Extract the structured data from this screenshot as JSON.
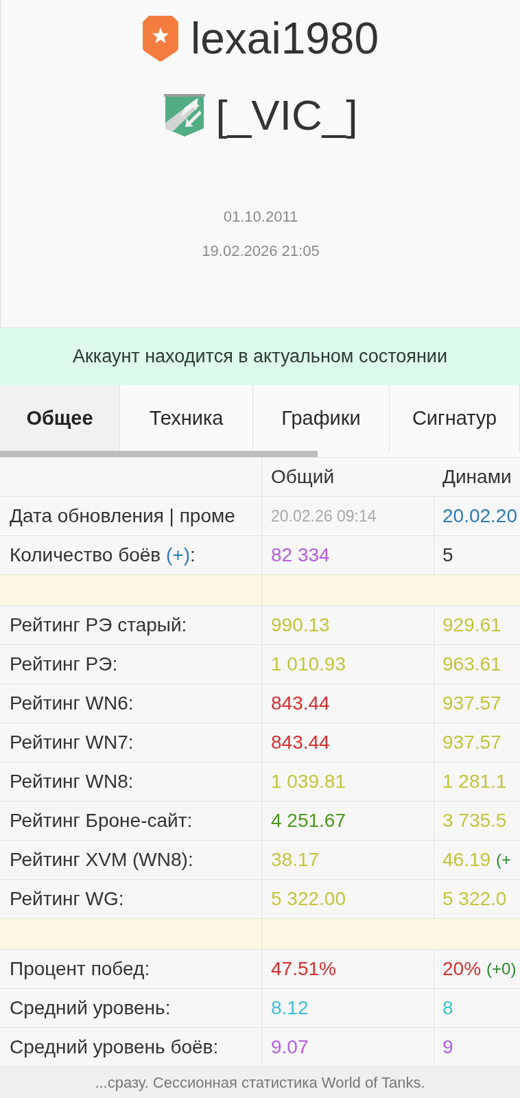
{
  "profile": {
    "username": "lexai1980",
    "clan_tag": "[_VIC_]",
    "dates": [
      "01.10.2011",
      "19.02.2026 21:05"
    ]
  },
  "status_banner": "Аккаунт находится в актуальном состоянии",
  "tabs": [
    {
      "label": "Общее",
      "selected": true
    },
    {
      "label": "Техника",
      "selected": false
    },
    {
      "label": "Графики",
      "selected": false
    },
    {
      "label": "Сигнатур",
      "selected": false
    }
  ],
  "table": {
    "columns": [
      "Общий",
      "Динами"
    ],
    "rows": [
      {
        "kind": "date",
        "label": "Дата обновления | проме",
        "cells": [
          {
            "text": "20.02.26 09:14",
            "color": "#a9a9a9"
          },
          {
            "text": "20.02.20",
            "color": "#2b7bb9"
          }
        ]
      },
      {
        "kind": "stat",
        "label": "Количество боёв",
        "link": "(+)",
        "suffix": ":",
        "cells": [
          {
            "text": "82 334",
            "color": "#b65ce0"
          },
          {
            "text": "5",
            "color": "#333333"
          }
        ]
      },
      {
        "kind": "spacer"
      },
      {
        "kind": "stat",
        "label": "Рейтинг РЭ старый:",
        "cells": [
          {
            "text": "990.13",
            "color": "#c4c43a"
          },
          {
            "text": "929.61",
            "color": "#c4c43a"
          }
        ]
      },
      {
        "kind": "stat",
        "label": "Рейтинг РЭ:",
        "cells": [
          {
            "text": "1 010.93",
            "color": "#c4c43a"
          },
          {
            "text": "963.61",
            "color": "#c4c43a"
          }
        ]
      },
      {
        "kind": "stat",
        "label": "Рейтинг WN6:",
        "cells": [
          {
            "text": "843.44",
            "color": "#d62f2f"
          },
          {
            "text": "937.57",
            "color": "#c4c43a"
          }
        ]
      },
      {
        "kind": "stat",
        "label": "Рейтинг WN7:",
        "cells": [
          {
            "text": "843.44",
            "color": "#d62f2f"
          },
          {
            "text": "937.57",
            "color": "#c4c43a"
          }
        ]
      },
      {
        "kind": "stat",
        "label": "Рейтинг WN8:",
        "cells": [
          {
            "text": "1 039.81",
            "color": "#c4c43a"
          },
          {
            "text": "1 281.1",
            "color": "#c4c43a"
          }
        ]
      },
      {
        "kind": "stat",
        "label": "Рейтинг Броне-сайт:",
        "cells": [
          {
            "text": "4 251.67",
            "color": "#4a9a1b"
          },
          {
            "text": "3 735.5",
            "color": "#c4c43a"
          }
        ]
      },
      {
        "kind": "stat",
        "label": "Рейтинг XVM (WN8):",
        "cells": [
          {
            "text": "38.17",
            "color": "#c4c43a"
          },
          {
            "text": "46.19",
            "color": "#c4c43a",
            "delta": {
              "text": "(+",
              "color": "#2a8a2a"
            }
          }
        ]
      },
      {
        "kind": "stat",
        "label": "Рейтинг WG:",
        "cells": [
          {
            "text": "5 322.00",
            "color": "#c4c43a"
          },
          {
            "text": "5 322.0",
            "color": "#c4c43a"
          }
        ]
      },
      {
        "kind": "spacer"
      },
      {
        "kind": "stat",
        "label": "Процент побед:",
        "cells": [
          {
            "text": "47.51%",
            "color": "#d62f2f"
          },
          {
            "text": "20%",
            "color": "#d62f2f",
            "delta": {
              "text": "(+0)",
              "color": "#2a8a2a"
            }
          }
        ]
      },
      {
        "kind": "stat",
        "label": "Средний уровень:",
        "cells": [
          {
            "text": "8.12",
            "color": "#3ebfd3"
          },
          {
            "text": "8",
            "color": "#3ebfd3"
          }
        ]
      },
      {
        "kind": "stat",
        "label": "Средний уровень боёв:",
        "cells": [
          {
            "text": "9.07",
            "color": "#b65ce0"
          },
          {
            "text": "9",
            "color": "#b65ce0"
          }
        ]
      }
    ]
  },
  "footer": "...сразу. Сессионная статистика World of Tanks."
}
